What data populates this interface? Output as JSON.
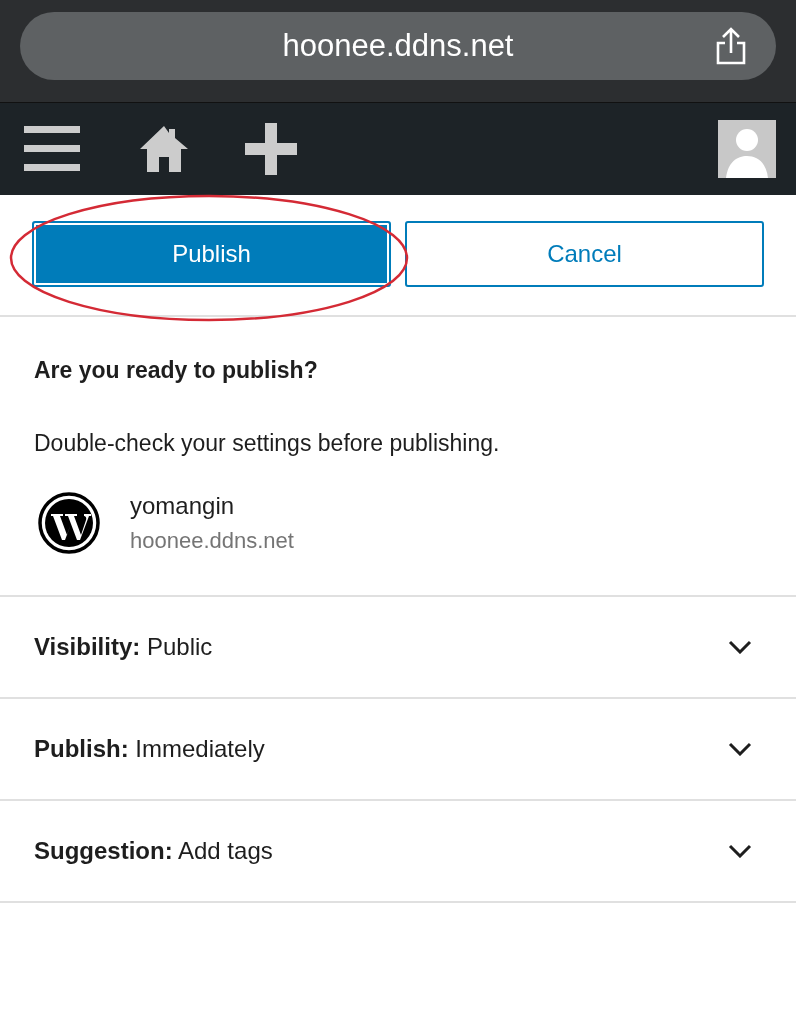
{
  "browser": {
    "url": "hoonee.ddns.net"
  },
  "actions": [
    {
      "label": "Publish",
      "kind": "primary"
    },
    {
      "label": "Cancel",
      "kind": "secondary"
    }
  ],
  "annotation": {
    "kind": "ellipse",
    "color": "#d42a35"
  },
  "panel": {
    "title": "Are you ready to publish?",
    "description": "Double-check your settings before publishing.",
    "site": {
      "name": "yomangin",
      "url": "hoonee.ddns.net"
    }
  },
  "settings": [
    {
      "label": "Visibility:",
      "value": "Public",
      "expanded": false
    },
    {
      "label": "Publish:",
      "value": "Immediately",
      "expanded": false
    },
    {
      "label": "Suggestion:",
      "value": "Add tags",
      "expanded": false
    }
  ]
}
